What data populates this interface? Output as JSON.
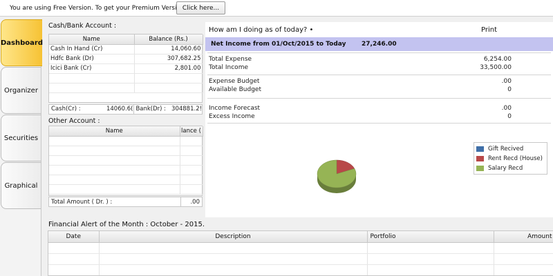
{
  "banner": {
    "text": "You are using Free Version. To get your Premium Version.",
    "button_label": "Click here..."
  },
  "tabs": [
    {
      "label": "Dashboard",
      "active": true
    },
    {
      "label": "Organizer",
      "active": false
    },
    {
      "label": "Securities",
      "active": false
    },
    {
      "label": "Graphical",
      "active": false
    }
  ],
  "cash_bank": {
    "title": "Cash/Bank Account :",
    "columns": [
      "Name",
      "Balance (Rs.)"
    ],
    "rows": [
      {
        "name": "Cash In Hand (Cr)",
        "balance": "14,060.60"
      },
      {
        "name": "Hdfc Bank (Dr)",
        "balance": "307,682.25"
      },
      {
        "name": "Icici Bank (Cr)",
        "balance": "2,801.00"
      }
    ],
    "summary": {
      "cash_label": "Cash(Cr) :",
      "cash_value": "14060.6(",
      "bank_label": "Bank(Dr) :",
      "bank_value": "304881.2!"
    }
  },
  "other_account": {
    "title": "Other Account :",
    "columns": [
      "Name",
      "lance ("
    ],
    "total_label": "Total Amount ( Dr. ) :",
    "total_value": ".00"
  },
  "dashboard": {
    "heading": "How am I doing as of today? •",
    "print_label": "Print",
    "net_income_label": "Net Income from 01/Oct/2015 to Today",
    "net_income_value": "27,246.00",
    "rows": [
      {
        "label": "Total Expense",
        "value": "6,254.00"
      },
      {
        "label": "Total Income",
        "value": "33,500.00"
      },
      {
        "label": "Expense Budget",
        "value": ".00"
      },
      {
        "label": "Available Budget",
        "value": "0"
      },
      {
        "label": "Income Forecast",
        "value": ".00"
      },
      {
        "label": "Excess Income",
        "value": "0"
      }
    ]
  },
  "chart_data": {
    "type": "pie",
    "title": "",
    "categories": [
      "Gift Recived",
      "Rent Recd (House)",
      "Salary Recd"
    ],
    "values": [
      0,
      6254,
      27246
    ],
    "colors": [
      "#3f6fa8",
      "#b84848",
      "#96b455"
    ],
    "legend_position": "right"
  },
  "alert": {
    "title": "Financial Alert of the Month : October - 2015.",
    "columns": [
      "Date",
      "Description",
      "Portfolio",
      "Amount"
    ]
  }
}
